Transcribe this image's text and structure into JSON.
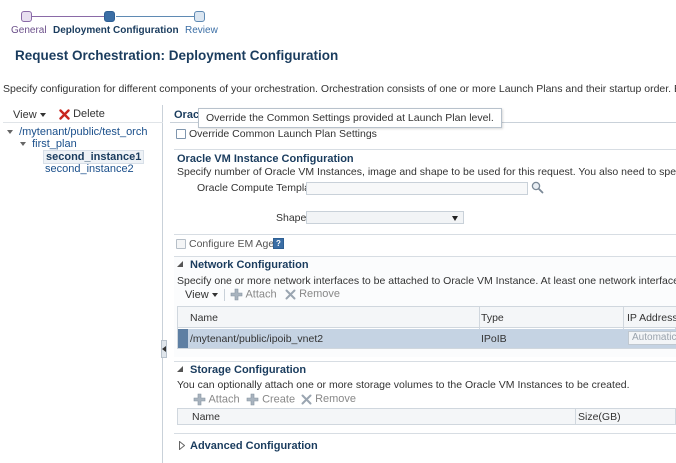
{
  "train": {
    "steps": [
      {
        "label": "General",
        "state": "visited"
      },
      {
        "label": "Deployment Configuration",
        "state": "current"
      },
      {
        "label": "Review",
        "state": "unvisited"
      }
    ]
  },
  "page": {
    "title": "Request Orchestration: Deployment Configuration",
    "description": "Specify configuration for different components of your orchestration. Orchestration consists of one or more Launch Plans and their startup order. Each Launch Plan con"
  },
  "tree": {
    "view_label": "View",
    "delete_label": "Delete",
    "nodes": [
      {
        "label": "/mytenant/public/test_orch",
        "level": 0,
        "expanded": true,
        "selected": false
      },
      {
        "label": "first_plan",
        "level": 1,
        "expanded": true,
        "selected": false
      },
      {
        "label": "second_instance1",
        "level": 2,
        "expanded": false,
        "selected": true
      },
      {
        "label": "second_instance2",
        "level": 2,
        "expanded": false,
        "selected": false
      }
    ]
  },
  "detail": {
    "tab_label": "Oracl",
    "tooltip": "Override the Common Settings provided at Launch Plan level.",
    "override_label": "Override Common Launch Plan Settings",
    "vm_section": {
      "title": "Oracle VM Instance Configuration",
      "description": "Specify number of Oracle VM Instances, image and shape to be used for this request. You also need to specify a Public key f",
      "template_label": "Oracle Compute Template",
      "template_value": "",
      "shape_label": "Shape",
      "shape_value": ""
    },
    "em_agent_label": "Configure EM Agent",
    "help_glyph": "?",
    "network": {
      "title": "Network Configuration",
      "description": "Specify one or more network interfaces to be attached to Oracle VM Instance. At least one network interface must be config",
      "view_label": "View",
      "attach_label": "Attach",
      "remove_label": "Remove",
      "columns": [
        "Name",
        "Type",
        "IP Address"
      ],
      "rows": [
        {
          "name": "/mytenant/public/ipoib_vnet2",
          "type": "IPoIB",
          "ip_address": "Automatic"
        }
      ]
    },
    "storage": {
      "title": "Storage Configuration",
      "description": "You can optionally attach one or more storage volumes to the Oracle VM Instances to be created.",
      "attach_label": "Attach",
      "create_label": "Create",
      "remove_label": "Remove",
      "columns": [
        "Name",
        "Size(GB)"
      ]
    },
    "advanced": {
      "title": "Advanced Configuration"
    }
  },
  "colors": {
    "accent_blue": "#3b6ea5",
    "title_blue": "#1a3c5e",
    "selected_row": "#c5d3e3",
    "panel_border": "#c9d1d9",
    "delete_red": "#c8261e",
    "train_visited": "#8a6aa7"
  }
}
